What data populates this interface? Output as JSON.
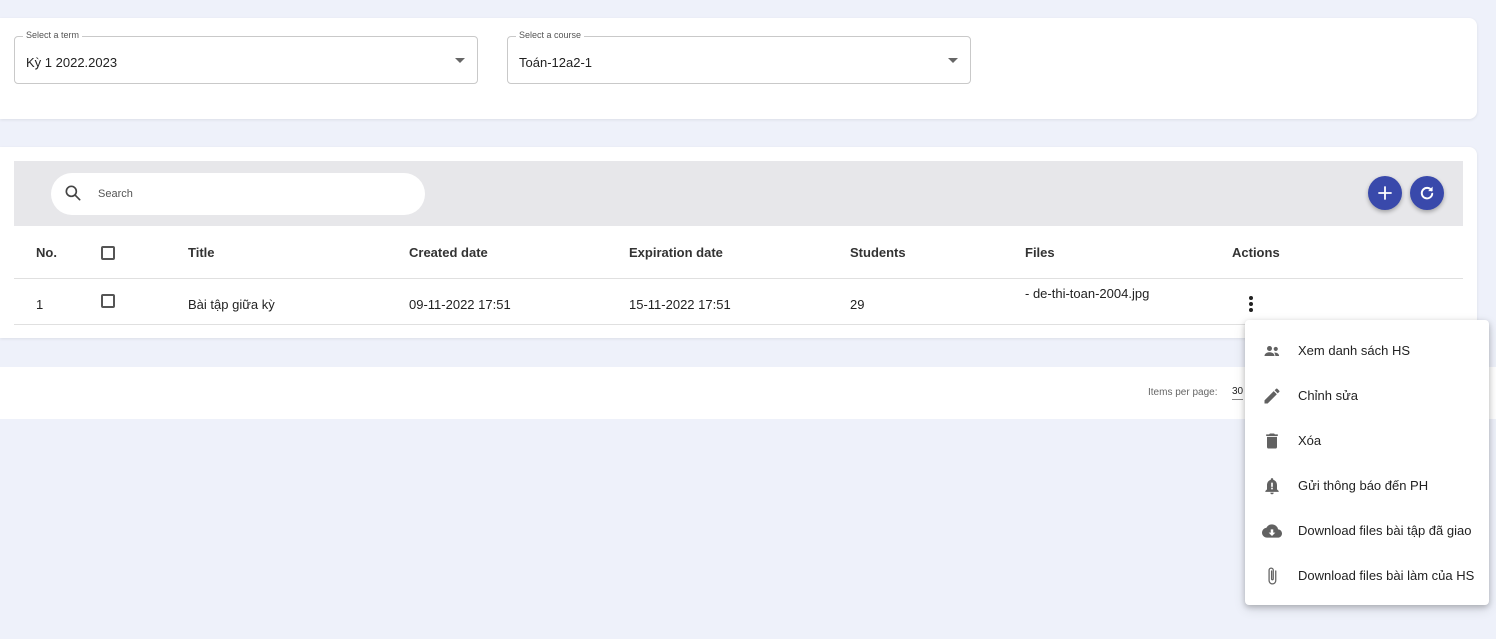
{
  "filters": {
    "term": {
      "legend": "Select a term",
      "value": "Kỳ 1 2022.2023"
    },
    "course": {
      "legend": "Select a course",
      "value": "Toán-12a2-1"
    }
  },
  "toolbar": {
    "search_placeholder": "Search",
    "add_icon": "plus-icon",
    "refresh_icon": "refresh-icon",
    "accent_color": "#3949ab"
  },
  "table": {
    "headers": {
      "no": "No.",
      "title": "Title",
      "created": "Created date",
      "expiration": "Expiration date",
      "students": "Students",
      "files": "Files",
      "actions": "Actions"
    },
    "rows": [
      {
        "no": "1",
        "title": "Bài tập giữa kỳ",
        "created": "09-11-2022 17:51",
        "expiration": "15-11-2022 17:51",
        "students": "29",
        "files": "- de-thi-toan-2004.jpg"
      }
    ]
  },
  "paginator": {
    "label": "Items per page:",
    "page_size": "30"
  },
  "menu": {
    "items": [
      {
        "label": "Xem danh sách HS",
        "icon": "group-icon"
      },
      {
        "label": "Chỉnh sửa",
        "icon": "pencil-icon"
      },
      {
        "label": "Xóa",
        "icon": "trash-icon"
      },
      {
        "label": "Gửi thông báo đến PH",
        "icon": "bell-icon"
      },
      {
        "label": "Download files bài tập đã giao",
        "icon": "cloud-download-icon"
      },
      {
        "label": "Download files bài làm của HS",
        "icon": "paperclip-icon"
      }
    ]
  }
}
